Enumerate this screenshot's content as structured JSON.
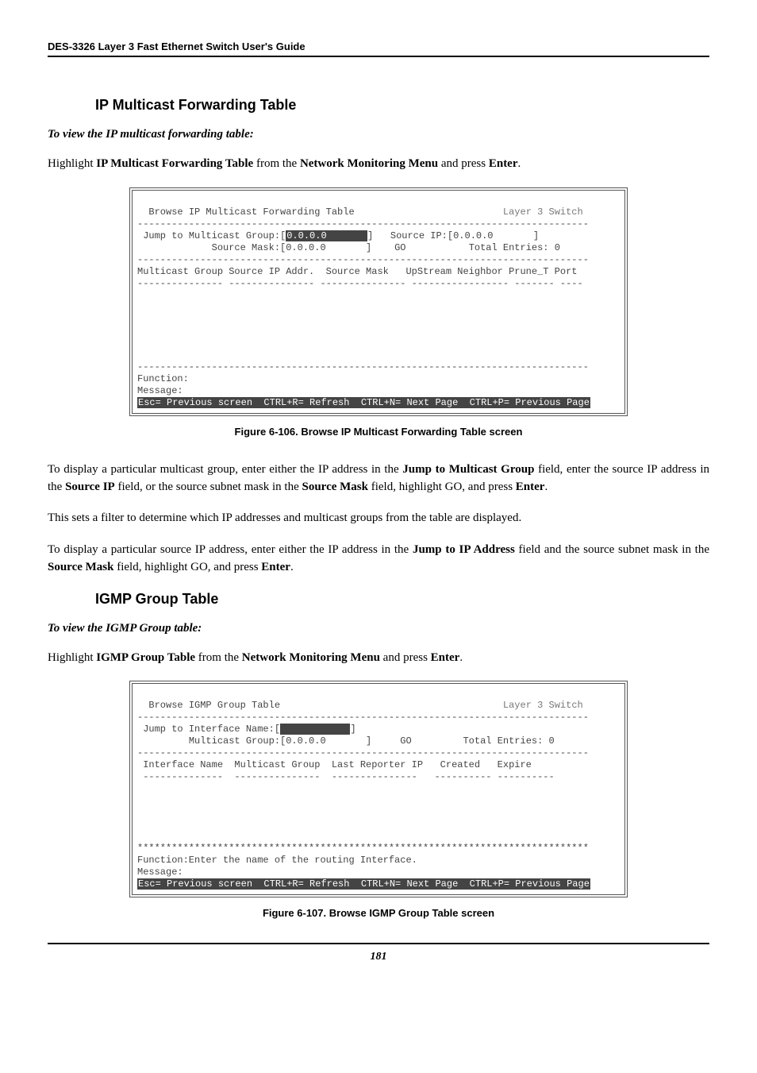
{
  "header": "DES-3326 Layer 3 Fast Ethernet Switch User's Guide",
  "section1": {
    "heading": "IP Multicast Forwarding Table",
    "subheading": "To view the IP multicast forwarding table:",
    "intro_prefix": "Highlight ",
    "intro_bold1": "IP Multicast Forwarding Table",
    "intro_mid": " from the ",
    "intro_bold2": "Network Monitoring Menu",
    "intro_mid2": " and press ",
    "intro_bold3": "Enter",
    "intro_suffix": "."
  },
  "terminal1": {
    "title_left": "Browse IP Multicast Forwarding Table",
    "title_right": "Layer 3 Switch",
    "row2a_label": "Jump to Multicast Group:[",
    "row2a_val": "0.0.0.0       ",
    "row2a_close": "]",
    "row2a_r_label": "Source IP:[0.0.0.0       ]",
    "row2b_label": "            Source Mask:[0.0.0.0       ]",
    "row2b_go": "GO",
    "row2b_total": "Total Entries: 0",
    "cols": "Multicast Group Source IP Addr.  Source Mask   UpStream Neighbor Prune_T Port",
    "func": "Function:",
    "msg": "Message:",
    "footer": "Esc= Previous screen  CTRL+R= Refresh  CTRL+N= Next Page  CTRL+P= Previous Page"
  },
  "caption1": "Figure 6-106.  Browse IP Multicast Forwarding Table screen",
  "para1": {
    "t1": "To display a particular multicast group, enter either the IP address in the ",
    "b1": "Jump to Multicast Group",
    "t2": " field, enter the source IP address in the ",
    "b2": "Source IP",
    "t3": " field, or the source subnet mask in the ",
    "b3": "Source Mask",
    "t4": " field, highlight GO, and press ",
    "b4": "Enter",
    "t5": "."
  },
  "para2": "This sets a filter to determine which IP addresses and multicast groups from the table are displayed.",
  "para3": {
    "t1": "To display a particular source IP address, enter either the IP address in the ",
    "b1": "Jump to IP Address",
    "t2": " field and the source subnet mask in the ",
    "b2": "Source Mask",
    "t3": " field, highlight GO, and press ",
    "b3": "Enter",
    "t4": "."
  },
  "section2": {
    "heading": "IGMP Group Table",
    "subheading": "To view the IGMP Group table:",
    "intro_prefix": "Highlight ",
    "intro_bold1": "IGMP Group Table",
    "intro_mid": " from the ",
    "intro_bold2": "Network Monitoring Menu",
    "intro_mid2": " and press ",
    "intro_bold3": "Enter",
    "intro_suffix": "."
  },
  "terminal2": {
    "title_left": "Browse IGMP Group Table",
    "title_right": "Layer 3 Switch",
    "row2a_label": "Jump to Interface Name:[",
    "row2a_val": "            ",
    "row2a_close": "]",
    "row2b_label": "        Multicast Group:[0.0.0.0       ]",
    "row2b_go": "GO",
    "row2b_total": "Total Entries: 0",
    "cols": "Interface Name  Multicast Group  Last Reporter IP   Created   Expire",
    "stars": "*******************************************************************************",
    "func": "Function:Enter the name of the routing Interface.",
    "msg": "Message:",
    "footer": "Esc= Previous screen  CTRL+R= Refresh  CTRL+N= Next Page  CTRL+P= Previous Page"
  },
  "caption2": "Figure 6-107.  Browse IGMP Group Table screen",
  "pageNumber": "181"
}
